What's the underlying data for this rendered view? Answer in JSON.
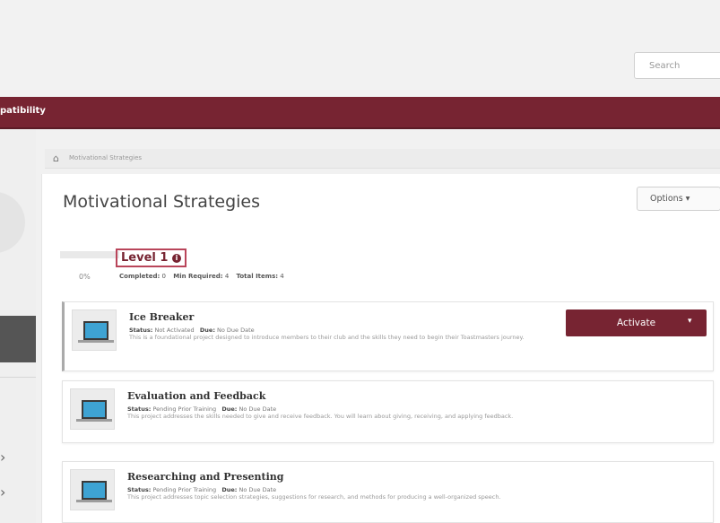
{
  "search": {
    "placeholder": "Search"
  },
  "nav": {
    "text": "patibility"
  },
  "breadcrumb": {
    "text": "Motivational Strategies"
  },
  "page": {
    "title": "Motivational Strategies",
    "options_label": "Options ▾"
  },
  "level": {
    "name": "Level 1",
    "progress_text": "0%",
    "progress_fraction": 0,
    "completed_label": "Completed:",
    "completed_value": "0",
    "min_required_label": "Min Required:",
    "min_required_value": "4",
    "total_items_label": "Total Items:",
    "total_items_value": "4"
  },
  "projects": [
    {
      "title": "Ice Breaker",
      "status_label": "Status:",
      "status_value": "Not Activated",
      "due_label": "Due:",
      "due_value": "No Due Date",
      "description": "This is a foundational project designed to introduce members to their club and the skills they need to begin their Toastmasters journey."
    },
    {
      "title": "Evaluation and Feedback",
      "status_label": "Status:",
      "status_value": "Pending Prior Training",
      "due_label": "Due:",
      "due_value": "No Due Date",
      "description": "This project addresses the skills needed to give and receive feedback. You will learn about giving, receiving, and applying feedback."
    },
    {
      "title": "Researching and Presenting",
      "status_label": "Status:",
      "status_value": "Pending Prior Training",
      "due_label": "Due:",
      "due_value": "No Due Date",
      "description": "This project addresses topic selection strategies, suggestions for research, and methods for producing a well-organized speech."
    }
  ],
  "activate": {
    "label": "Activate",
    "caret": "▾"
  },
  "sidebar": {
    "chevron": "›"
  },
  "colors": {
    "brand": "#772432",
    "thumb_screen": "#3ea3d3"
  }
}
